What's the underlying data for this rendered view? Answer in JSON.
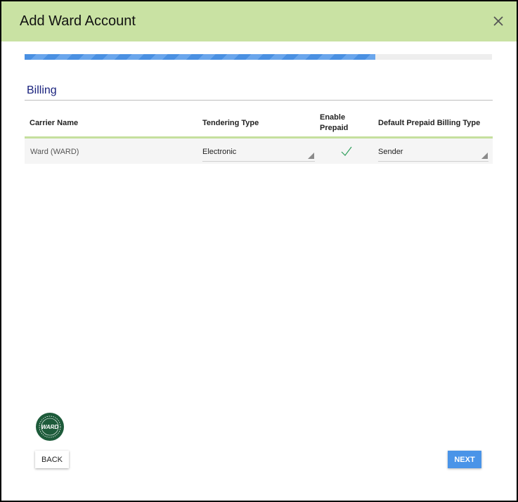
{
  "dialog": {
    "title": "Add Ward Account",
    "close_icon": "close-icon"
  },
  "progress": {
    "fraction": 0.75,
    "color": "#4a90e2"
  },
  "section": {
    "title": "Billing"
  },
  "table": {
    "headers": {
      "carrier_name": "Carrier Name",
      "tendering_type": "Tendering Type",
      "enable_prepaid_line1": "Enable",
      "enable_prepaid_line2": "Prepaid",
      "default_prepaid_billing_type": "Default Prepaid Billing Type"
    },
    "rows": [
      {
        "carrier_name": "Ward (WARD)",
        "tendering_type": "Electronic",
        "enable_prepaid": true,
        "default_prepaid_billing_type": "Sender"
      }
    ]
  },
  "logo": {
    "name": "ward-logo",
    "text": "WARD"
  },
  "buttons": {
    "back_label": "BACK",
    "next_label": "NEXT"
  },
  "colors": {
    "header_bg": "#c9e2a3",
    "accent": "#4a94e8",
    "section_title": "#1a237e",
    "logo_green": "#1d5b3a"
  }
}
